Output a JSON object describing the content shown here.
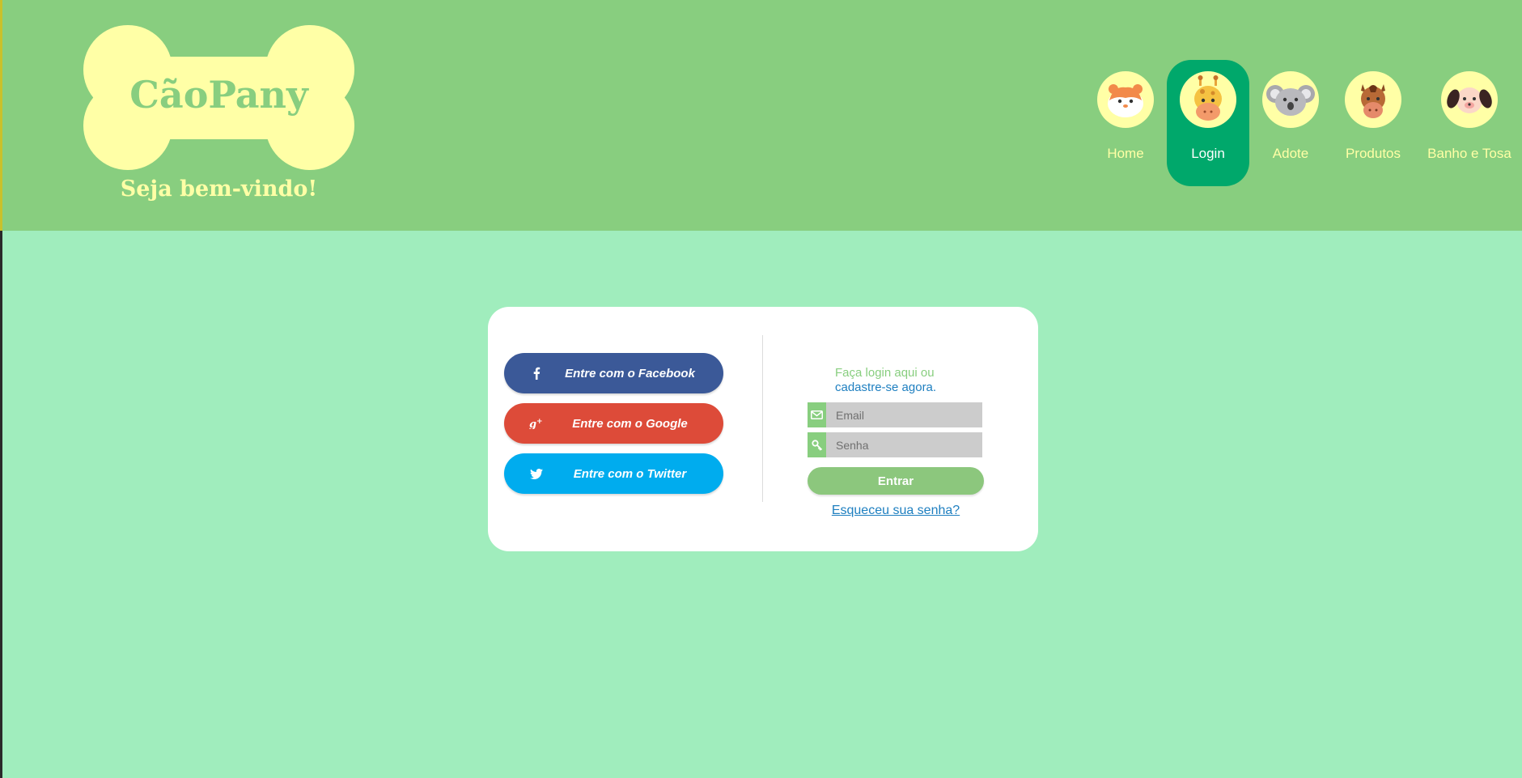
{
  "brand": {
    "name": "CãoPany",
    "tagline": "Seja bem-vindo!"
  },
  "nav": {
    "items": [
      {
        "label": "Home",
        "icon": "hamster-icon"
      },
      {
        "label": "Login",
        "icon": "giraffe-icon",
        "active": true
      },
      {
        "label": "Adote",
        "icon": "koala-icon"
      },
      {
        "label": "Produtos",
        "icon": "horse-icon"
      },
      {
        "label": "Banho e Tosa",
        "icon": "dog-icon"
      }
    ]
  },
  "login": {
    "social": {
      "facebook": "Entre com o Facebook",
      "google": "Entre com o Google",
      "twitter": "Entre com o Twitter"
    },
    "intro_line1": "Faça login aqui ou",
    "intro_link": "cadastre-se agora.",
    "email_placeholder": "Email",
    "password_placeholder": "Senha",
    "submit_label": "Entrar",
    "forgot_label": "Esqueceu sua senha?"
  },
  "colors": {
    "header_bg": "#88ce7f",
    "page_bg": "#a0edbd",
    "accent_yellow": "#ffffa6",
    "active_nav": "#00a86b",
    "facebook": "#3b5998",
    "google": "#dd4b39",
    "twitter": "#00acee",
    "link": "#1e7fc0"
  }
}
